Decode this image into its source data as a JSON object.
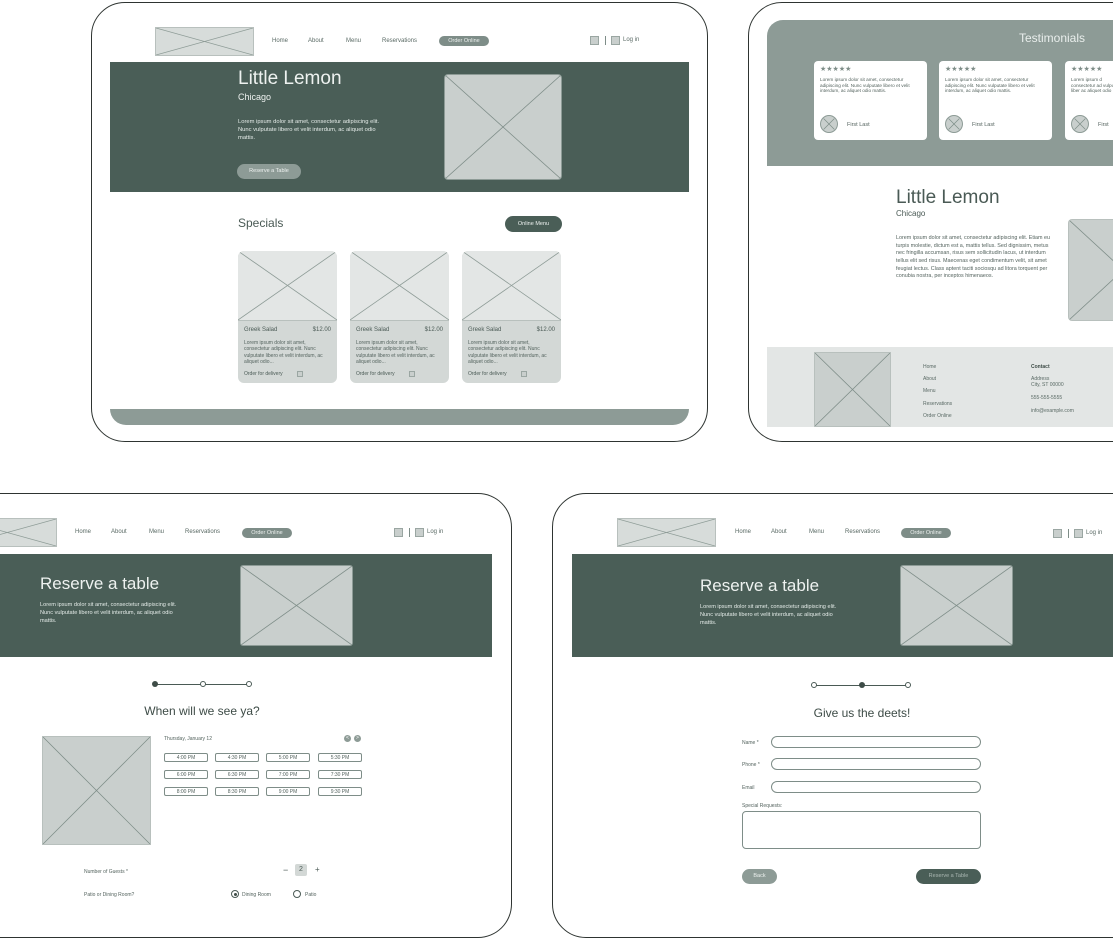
{
  "nav": {
    "items": [
      "Home",
      "About",
      "Menu",
      "Reservations"
    ],
    "order_online": "Order Online",
    "login": "Log in"
  },
  "screen1": {
    "hero_title": "Little Lemon",
    "hero_subtitle": "Chicago",
    "hero_text": "Lorem ipsum dolor sit amet, consectetur adipiscing elit. Nunc vulputate libero et velit interdum, ac aliquet odio mattis.",
    "reserve_button": "Reserve a Table",
    "specials_title": "Specials",
    "online_menu_button": "Online Menu",
    "cards": [
      {
        "name": "Greek Salad",
        "price": "$12.00",
        "desc": "Lorem ipsum dolor sit amet, consectetur adipiscing elit. Nunc vulputate libero et velit interdum, ac aliquet odio...",
        "cta": "Order for delivery"
      },
      {
        "name": "Greek Salad",
        "price": "$12.00",
        "desc": "Lorem ipsum dolor sit amet, consectetur adipiscing elit. Nunc vulputate libero et velit interdum, ac aliquet odio...",
        "cta": "Order for delivery"
      },
      {
        "name": "Greek Salad",
        "price": "$12.00",
        "desc": "Lorem ipsum dolor sit amet, consectetur adipiscing elit. Nunc vulputate libero et velit interdum, ac aliquet odio...",
        "cta": "Order for delivery"
      }
    ]
  },
  "screen2": {
    "testimonials_title": "Testimonials",
    "stars": "★★★★★",
    "testimonials": [
      {
        "text": "Lorem ipsum dolor sit amet, consectetur adipiscing elit. Nunc vulputate libero et velit interdum, ac aliquet odio mattis.",
        "name": "First Last"
      },
      {
        "text": "Lorem ipsum dolor sit amet, consectetur adipiscing elit. Nunc vulputate libero et velit interdum, ac aliquet odio mattis.",
        "name": "First Last"
      },
      {
        "text": "Lorem ipsum d consectetur ad vulputate liber ac aliquet odio",
        "name": "First"
      }
    ],
    "about_title": "Little Lemon",
    "about_subtitle": "Chicago",
    "about_text": "Lorem ipsum dolor sit amet, consectetur adipiscing elit. Etiam eu turpis molestie, dictum est a, mattis tellus. Sed dignissim, metus nec fringilla accumsan, risus sem sollicitudin lacus, ut interdum tellus elit sed risus. Maecenas eget condimentum velit, sit amet feugiat lectus. Class aptent taciti sociosqu ad litora torquent per conubia nostra, per inceptos himenaeos.",
    "footer_links": [
      "Home",
      "About",
      "Menu",
      "Reservations",
      "Order Online"
    ],
    "contact_title": "Contact",
    "contact_address": "Address",
    "contact_city": "City, ST 00000",
    "contact_phone": "555-555-5555",
    "contact_email": "info@example.com"
  },
  "screen3": {
    "hero_title": "Reserve a table",
    "hero_text": "Lorem ipsum dolor sit amet, consectetur adipiscing elit. Nunc vulputate libero et velit interdum, ac aliquet odio mattis.",
    "question": "When will we see ya?",
    "date": "Thursday, January 12",
    "prev": "<",
    "next": ">",
    "slots": [
      "4:00 PM",
      "4:30 PM",
      "5:00 PM",
      "5:30 PM",
      "6:00 PM",
      "6:30 PM",
      "7:00 PM",
      "7:30 PM",
      "8:00 PM",
      "8:30 PM",
      "9:00 PM",
      "9:30 PM"
    ],
    "guests_label": "Number of Guests *",
    "minus": "−",
    "guests_value": "2",
    "plus": "+",
    "seating_label": "Patio or Dining Room?",
    "option_dining": "Dining Room",
    "option_patio": "Patio"
  },
  "screen4": {
    "hero_title": "Reserve a table",
    "hero_text": "Lorem ipsum dolor sit amet, consectetur adipiscing elit. Nunc vulputate libero et velit interdum, ac aliquet odio mattis.",
    "question": "Give us the deets!",
    "name_label": "Name *",
    "phone_label": "Phone *",
    "email_label": "Email",
    "requests_label": "Special Requests:",
    "back_button": "Back",
    "reserve_button": "Reserve a Table"
  }
}
